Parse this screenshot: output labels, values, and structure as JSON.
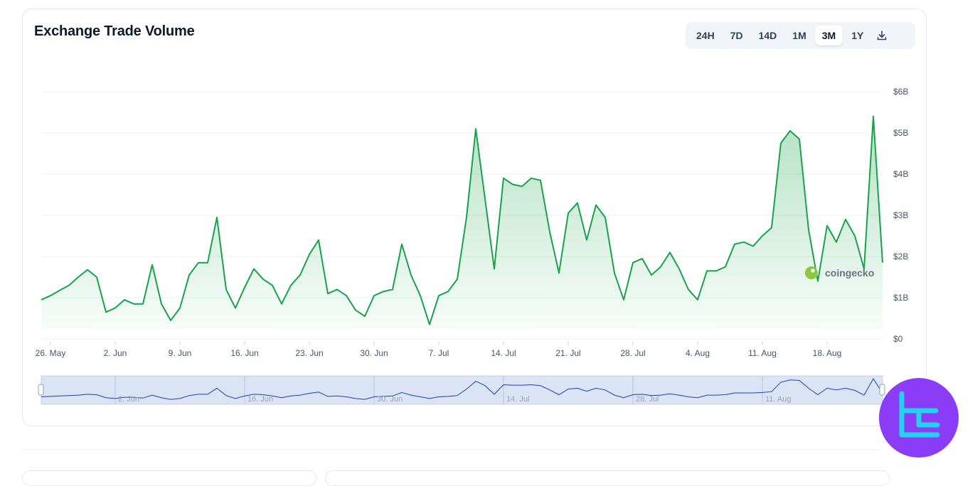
{
  "header": {
    "title": "Exchange Trade Volume",
    "range_options": [
      "24H",
      "7D",
      "14D",
      "1M",
      "3M",
      "1Y"
    ],
    "selected_range": "3M",
    "download_icon": "download-icon"
  },
  "watermark": {
    "text": "coingecko",
    "icon": "coingecko-gecko-icon"
  },
  "brand_logo": {
    "icon": "tl-logo-icon",
    "background": "#8b3cf6",
    "stroke": "#22d3ee"
  },
  "colors": {
    "line": "#16a34a",
    "navigator_line": "#1e40af",
    "navigator_fill": "#dbe4f5"
  },
  "chart_data": {
    "type": "area",
    "title": "Exchange Trade Volume",
    "xlabel": "",
    "ylabel": "",
    "x_ticks": [
      "26. May",
      "2. Jun",
      "9. Jun",
      "16. Jun",
      "23. Jun",
      "30. Jun",
      "7. Jul",
      "14. Jul",
      "21. Jul",
      "28. Jul",
      "4. Aug",
      "11. Aug",
      "18. Aug"
    ],
    "y_ticks": [
      "$0",
      "$1B",
      "$2B",
      "$3B",
      "$4B",
      "$5B",
      "$6B"
    ],
    "ylim": [
      0,
      6
    ],
    "y_unit": "billion USD",
    "grid": true,
    "legend": "none",
    "navigator_ticks": [
      "2. Jun",
      "16. Jun",
      "30. Jun",
      "14. Jul",
      "28. Jul",
      "11. Aug"
    ],
    "series": [
      {
        "values": [
          0.95,
          1.05,
          1.18,
          1.3,
          1.5,
          1.68,
          1.5,
          0.65,
          0.75,
          0.95,
          0.85,
          0.85,
          1.8,
          0.85,
          0.45,
          0.75,
          1.55,
          1.85,
          1.85,
          2.95,
          1.2,
          0.75,
          1.25,
          1.7,
          1.45,
          1.3,
          0.85,
          1.3,
          1.55,
          2.05,
          2.4,
          1.1,
          1.2,
          1.05,
          0.7,
          0.55,
          1.05,
          1.15,
          1.2,
          2.3,
          1.55,
          1.05,
          0.35,
          1.05,
          1.15,
          1.45,
          2.95,
          5.1,
          3.4,
          1.7,
          3.9,
          3.75,
          3.7,
          3.9,
          3.85,
          2.6,
          1.6,
          3.05,
          3.3,
          2.4,
          3.25,
          2.95,
          1.6,
          0.95,
          1.85,
          1.95,
          1.55,
          1.75,
          2.1,
          1.7,
          1.2,
          0.95,
          1.65,
          1.65,
          1.75,
          2.3,
          2.35,
          2.25,
          2.5,
          2.7,
          4.75,
          5.05,
          4.85,
          2.65,
          1.4,
          2.75,
          2.35,
          2.9,
          2.5,
          1.7,
          5.4,
          1.85
        ],
        "navigator_values": [
          1.3,
          1.35,
          1.4,
          1.45,
          1.5,
          1.6,
          1.55,
          1.2,
          1.1,
          1.25,
          1.25,
          1.15,
          1.5,
          1.2,
          1.0,
          1.1,
          1.45,
          1.6,
          1.6,
          2.3,
          1.45,
          1.1,
          1.4,
          1.6,
          1.55,
          1.4,
          1.2,
          1.4,
          1.5,
          1.7,
          1.85,
          1.35,
          1.4,
          1.3,
          1.1,
          1.0,
          1.3,
          1.35,
          1.4,
          1.8,
          1.5,
          1.3,
          1.1,
          1.3,
          1.35,
          1.45,
          2.2,
          3.1,
          2.6,
          1.6,
          2.7,
          2.65,
          2.65,
          2.7,
          2.6,
          2.1,
          1.55,
          2.2,
          2.3,
          1.95,
          2.3,
          2.1,
          1.5,
          1.2,
          1.55,
          1.6,
          1.45,
          1.5,
          1.65,
          1.5,
          1.3,
          1.2,
          1.5,
          1.5,
          1.55,
          1.75,
          1.75,
          1.75,
          1.8,
          1.9,
          3.0,
          3.25,
          3.2,
          2.3,
          1.55,
          2.3,
          2.1,
          2.3,
          2.05,
          1.5,
          3.4,
          1.7
        ]
      }
    ]
  }
}
